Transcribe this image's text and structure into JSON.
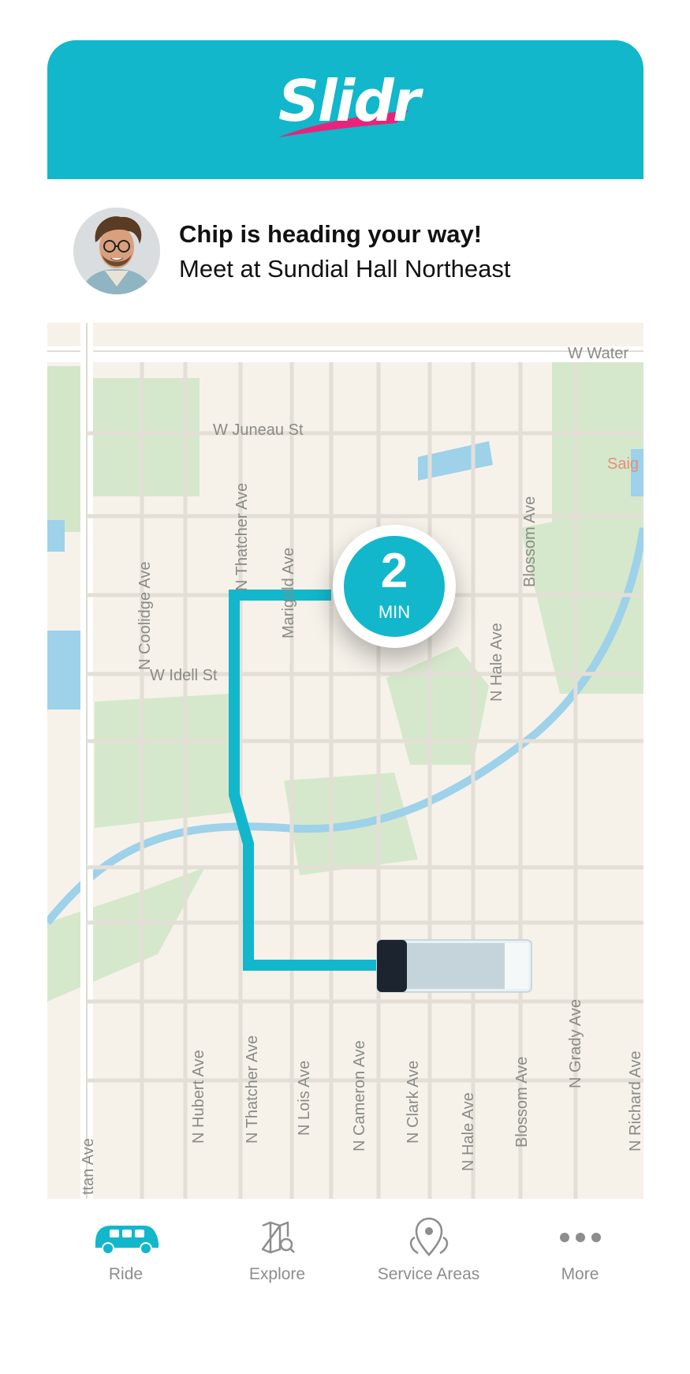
{
  "app": {
    "brand": "Slidr",
    "colors": {
      "accent": "#12b7cb",
      "brand_swoosh": "#e8247a",
      "tab_label": "#8d8d8d"
    }
  },
  "status": {
    "title": "Chip is heading your way!",
    "subtitle": "Meet at Sundial Hall Northeast",
    "avatar_icon": "driver-avatar"
  },
  "map": {
    "streets": {
      "w_water": "W Water",
      "w_juneau": "W Juneau St",
      "saig": "Saig",
      "n_thatcher_top": "N Thatcher Ave",
      "marigold": "Marigold Ave",
      "blossom_top": "Blossom Ave",
      "n_coolidge": "N Coolidge Ave",
      "w_idell": "W Idell St",
      "n_hale_top": "N Hale Ave",
      "n_hubert": "N Hubert Ave",
      "n_thatcher_bottom": "N Thatcher Ave",
      "n_lois": "N Lois Ave",
      "n_cameron": "N Cameron Ave",
      "n_clark": "N Clark Ave",
      "n_hale_bottom": "N Hale Ave",
      "blossom_bottom": "Blossom Ave",
      "n_grady": "N Grady Ave",
      "n_richard": "N Richard Ave",
      "manhattan": "ttan Ave"
    },
    "eta": {
      "value": "2",
      "unit": "MIN"
    },
    "vehicle_icon": "shuttle-top-view-icon"
  },
  "tabs": [
    {
      "label": "Ride",
      "icon": "shuttle-icon",
      "active": true
    },
    {
      "label": "Explore",
      "icon": "map-search-icon",
      "active": false
    },
    {
      "label": "Service Areas",
      "icon": "location-pins-icon",
      "active": false
    },
    {
      "label": "More",
      "icon": "more-dots-icon",
      "active": false
    }
  ]
}
